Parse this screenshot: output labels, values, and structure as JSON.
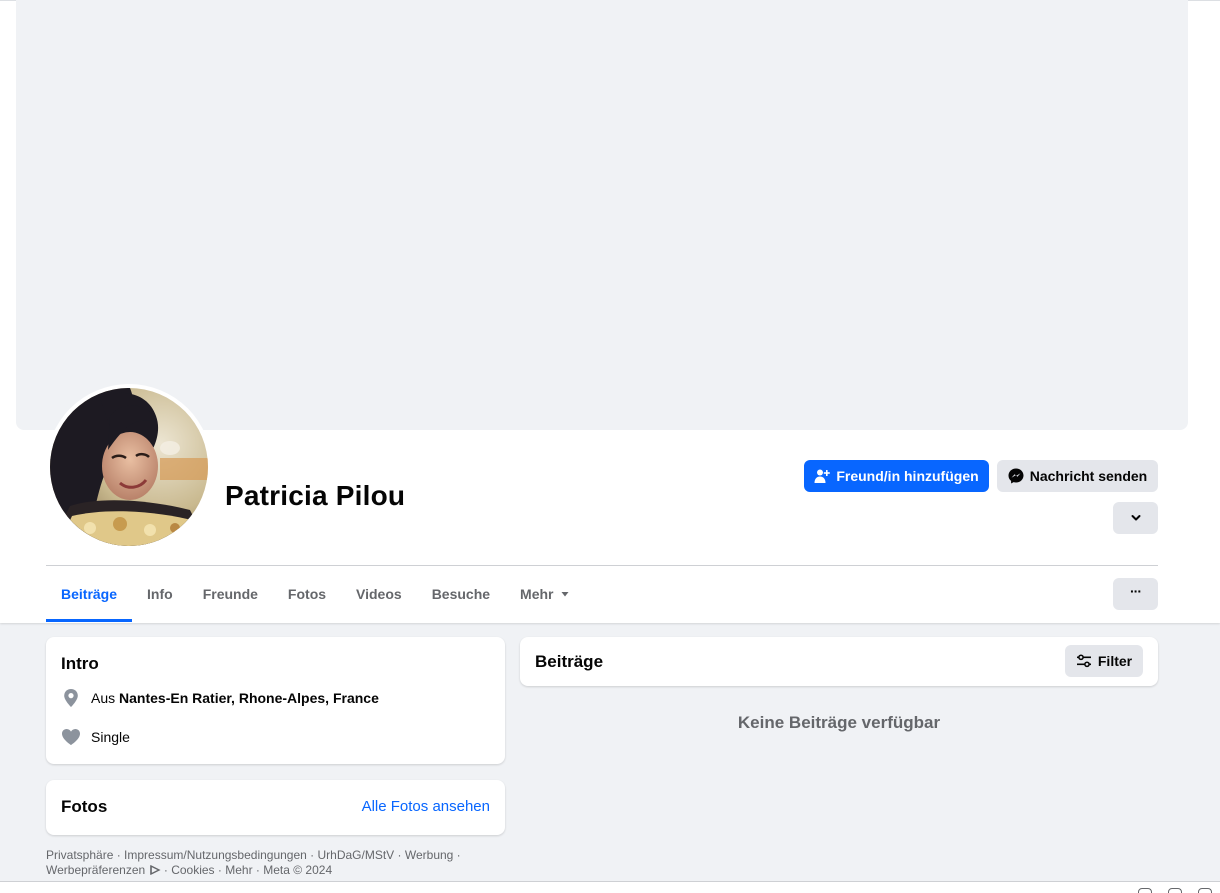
{
  "profile": {
    "name": "Patricia Pilou"
  },
  "actions": {
    "add_friend_label": "Freund/in hinzufügen",
    "message_label": "Nachricht senden"
  },
  "tabs": [
    {
      "label": "Beiträge",
      "active": true
    },
    {
      "label": "Info"
    },
    {
      "label": "Freunde"
    },
    {
      "label": "Fotos"
    },
    {
      "label": "Videos"
    },
    {
      "label": "Besuche"
    },
    {
      "label": "Mehr"
    }
  ],
  "more_menu_label": "···",
  "intro": {
    "title": "Intro",
    "location_prefix": "Aus",
    "location": "Nantes-En Ratier, Rhone-Alpes, France",
    "relationship": "Single"
  },
  "photos": {
    "title": "Fotos",
    "see_all_label": "Alle Fotos ansehen"
  },
  "posts": {
    "title": "Beiträge",
    "filter_label": "Filter",
    "empty_message": "Keine Beiträge verfügbar"
  },
  "footer": {
    "links": [
      "Privatsphäre",
      "Impressum/Nutzungsbedingungen",
      "UrhDaG/MStV",
      "Werbung",
      "Werbepräferenzen",
      "Cookies",
      "Mehr"
    ],
    "copyright": "Meta © 2024"
  },
  "colors": {
    "brand_blue": "#0866ff",
    "secondary_button": "#e4e6eb",
    "page_background": "#f0f2f5",
    "muted_text": "#65676b"
  },
  "icons": {
    "add_friend": "person-plus-icon",
    "message": "messenger-icon",
    "expand": "chevron-down-icon",
    "more": "ellipsis-icon",
    "tab_more": "caret-down-icon",
    "location": "map-pin-icon",
    "relationship": "heart-icon",
    "filter": "sliders-icon",
    "ad_choices": "ad-choices-icon"
  }
}
